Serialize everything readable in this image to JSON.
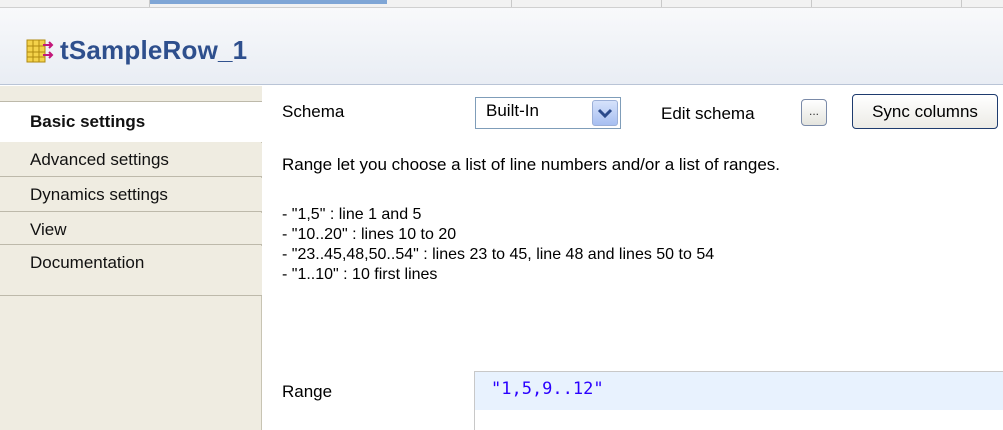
{
  "title": "tSampleRow_1",
  "tabs": [
    {
      "label": "Basic settings",
      "active": true
    },
    {
      "label": "Advanced settings",
      "active": false
    },
    {
      "label": "Dynamics settings",
      "active": false
    },
    {
      "label": "View",
      "active": false
    },
    {
      "label": "Documentation",
      "active": false
    }
  ],
  "schema": {
    "label": "Schema",
    "value": "Built-In",
    "edit_label": "Edit schema",
    "dots_label": "...",
    "sync_label": "Sync columns"
  },
  "help": {
    "intro": "Range let you choose a list of line numbers and/or a list of ranges.",
    "lines": [
      "- \"1,5\" : line 1 and 5",
      "- \"10..20\" : lines 10 to 20",
      "- \"23..45,48,50..54\" : lines 23 to 45, line 48 and lines 50 to 54",
      "- \"1..10\" : 10 first lines"
    ]
  },
  "range": {
    "label": "Range",
    "value": "\"1,5,9..12\""
  },
  "colors": {
    "title_text": "#2e4f8d",
    "sidebar_bg": "#efece1",
    "range_text": "#2a00ff",
    "range_highlight": "#e8f2fe"
  }
}
